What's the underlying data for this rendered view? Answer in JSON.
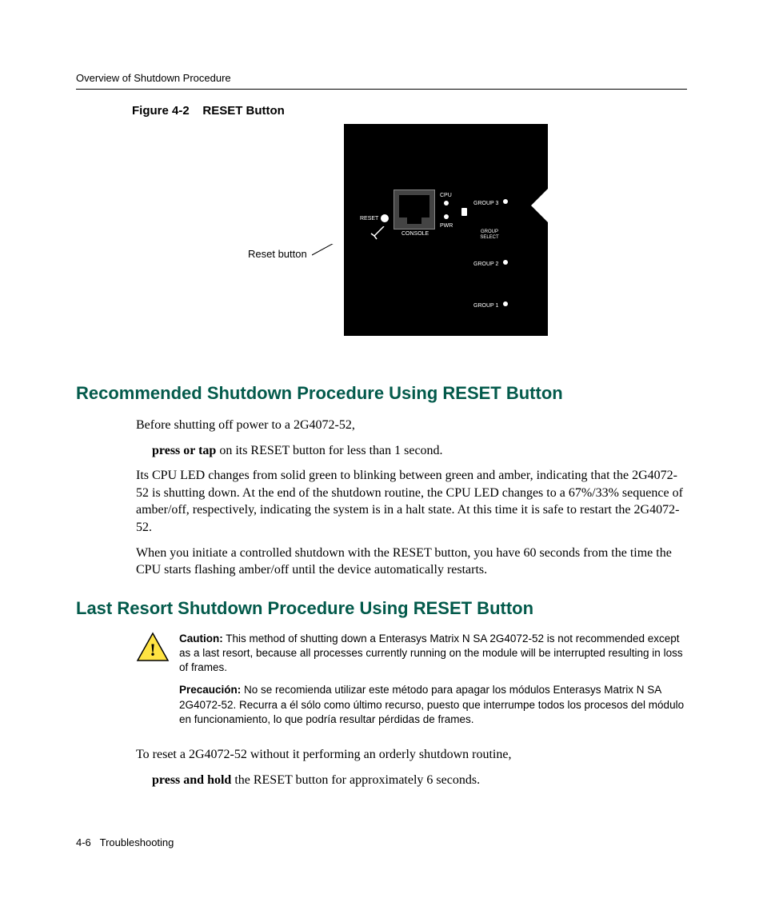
{
  "runningHead": "Overview of Shutdown Procedure",
  "figure": {
    "label": "Figure 4-2",
    "title": "RESET Button",
    "callout": "Reset button",
    "device": {
      "reset": "RESET",
      "console": "CONSOLE",
      "cpu": "CPU",
      "pwr": "PWR",
      "group1": "GROUP 1",
      "group2": "GROUP 2",
      "group3": "GROUP 3",
      "groupSelect": "GROUP SELECT"
    }
  },
  "section1": {
    "heading": "Recommended Shutdown Procedure Using RESET Button",
    "p1": "Before shutting off power to a 2G4072-52,",
    "p2_bold": "press or tap",
    "p2_rest": " on its RESET button for less than 1 second.",
    "p3": "Its CPU LED changes from solid green to blinking between green and amber, indicating that the 2G4072-52 is shutting down. At the end of the shutdown routine, the CPU LED changes to a 67%/33% sequence of amber/off, respectively, indicating the system is in a halt state. At this time it is safe to restart the 2G4072-52.",
    "p4": "When you initiate a controlled shutdown with the RESET button, you have 60 seconds from the time the CPU starts flashing amber/off until the device automatically restarts."
  },
  "section2": {
    "heading": "Last Resort Shutdown Procedure Using RESET Button",
    "caution_label": "Caution:",
    "caution_en": " This method of shutting down a Enterasys Matrix N SA 2G4072-52 is not recommended except as a last resort, because all processes currently running on the module will be interrupted resulting in loss of frames.",
    "precaucion_label": "Precaución:",
    "precaucion_es": " No se recomienda utilizar este método para apagar los módulos Enterasys Matrix N SA 2G4072-52. Recurra a él sólo como último recurso, puesto que interrumpe todos los procesos del módulo en funcionamiento, lo que podría resultar pérdidas de frames.",
    "p1": "To reset a 2G4072-52 without it performing an orderly shutdown routine,",
    "p2_bold": "press and hold",
    "p2_rest": " the RESET button for approximately 6 seconds."
  },
  "footer": {
    "pageNum": "4-6",
    "section": "Troubleshooting"
  }
}
